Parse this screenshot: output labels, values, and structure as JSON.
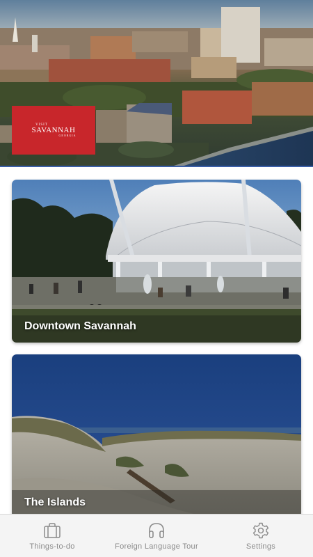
{
  "hero": {
    "logo": {
      "top_text": "VISIT",
      "name": "SAVANNAH",
      "sub_text": "GEORGIA"
    }
  },
  "cards": [
    {
      "title": "Downtown Savannah"
    },
    {
      "title": "The Islands"
    }
  ],
  "tabbar": {
    "tabs": [
      {
        "label": "Things-to-do",
        "icon": "briefcase-icon"
      },
      {
        "label": "Foreign Language Tour",
        "icon": "headphones-icon"
      },
      {
        "label": "Settings",
        "icon": "gear-icon"
      }
    ]
  },
  "colors": {
    "logo_red": "#c8262b",
    "tab_text": "#8a8a8a",
    "tab_bg": "#f4f4f4"
  }
}
